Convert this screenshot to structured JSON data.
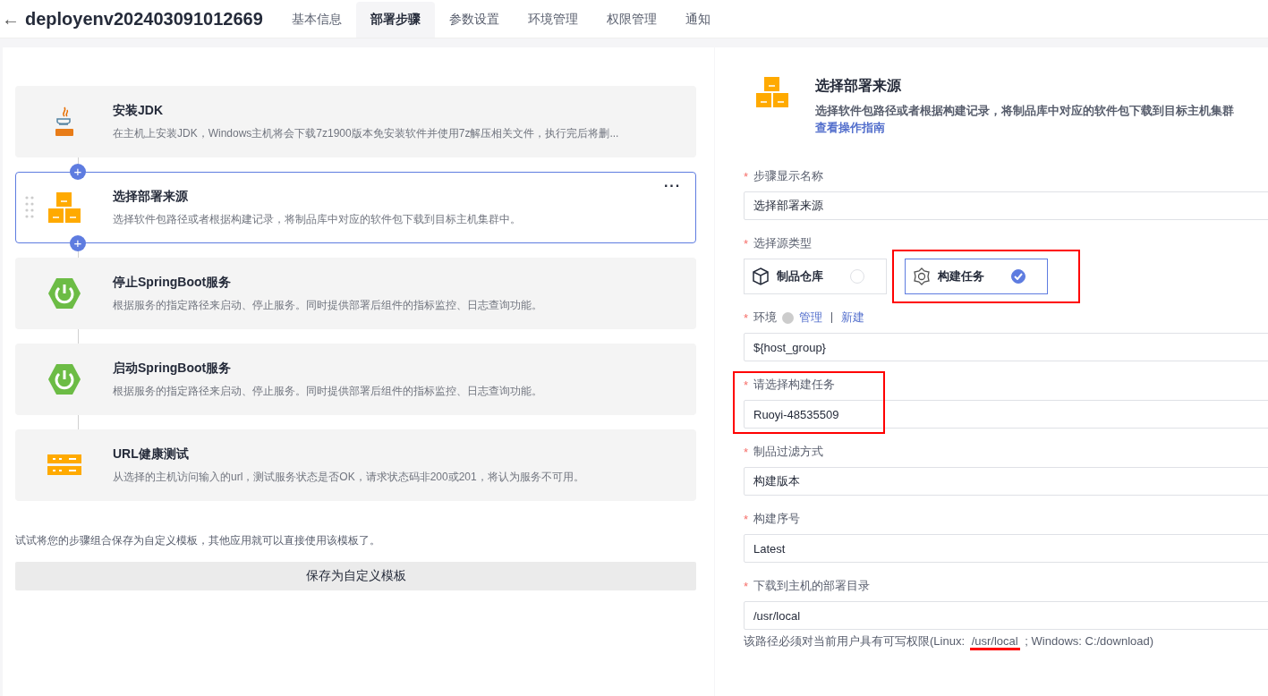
{
  "header": {
    "back": "←",
    "title": "deployenv202403091012669",
    "tabs": [
      {
        "label": "基本信息",
        "selected": false
      },
      {
        "label": "部署步骤",
        "selected": true
      },
      {
        "label": "参数设置",
        "selected": false
      },
      {
        "label": "环境管理",
        "selected": false
      },
      {
        "label": "权限管理",
        "selected": false
      },
      {
        "label": "通知",
        "selected": false
      }
    ]
  },
  "steps": [
    {
      "kind": "java",
      "title": "安装JDK",
      "desc": "在主机上安装JDK，Windows主机将会下载7z1900版本免安装软件并使用7z解压相关文件，执行完后将删...",
      "selected": false
    },
    {
      "kind": "boxes",
      "title": "选择部署来源",
      "desc": "选择软件包路径或者根据构建记录，将制品库中对应的软件包下载到目标主机集群中。",
      "selected": true,
      "add_before": "+",
      "add_after": "+",
      "more": "···"
    },
    {
      "kind": "spring",
      "title": "停止SpringBoot服务",
      "desc": "根据服务的指定路径来启动、停止服务。同时提供部署后组件的指标监控、日志查询功能。",
      "selected": false
    },
    {
      "kind": "spring",
      "title": "启动SpringBoot服务",
      "desc": "根据服务的指定路径来启动、停止服务。同时提供部署后组件的指标监控、日志查询功能。",
      "selected": false
    },
    {
      "kind": "server",
      "title": "URL健康测试",
      "desc": "从选择的主机访问输入的url，测试服务状态是否OK，请求状态码非200或201，将认为服务不可用。",
      "selected": false
    }
  ],
  "template_hint": "试试将您的步骤组合保存为自定义模板，其他应用就可以直接使用该模板了。",
  "save_template_button": "保存为自定义模板",
  "detail": {
    "title": "选择部署来源",
    "desc": "选择软件包路径或者根据构建记录，将制品库中对应的软件包下载到目标主机集群",
    "guide_link": "查看操作指南",
    "required_mark": "*",
    "fields": [
      {
        "kind": "input",
        "label": "步骤显示名称",
        "value": "选择部署来源",
        "highlighted": false
      },
      {
        "kind": "options",
        "label": "选择源类型",
        "highlighted": false,
        "options": [
          {
            "kind": "box",
            "label": "制品仓库",
            "selected": false,
            "highlighted": false
          },
          {
            "kind": "gear",
            "label": "构建任务",
            "selected": true,
            "highlighted": true
          }
        ]
      },
      {
        "kind": "input",
        "label": "环境",
        "value": "${host_group}",
        "highlighted": false,
        "links": [
          "管理",
          "新建"
        ]
      },
      {
        "kind": "input",
        "label": "请选择构建任务",
        "value": "Ruoyi-48535509",
        "highlighted": true
      },
      {
        "kind": "input",
        "label": "制品过滤方式",
        "value": "构建版本",
        "highlighted": false
      },
      {
        "kind": "input",
        "label": "构建序号",
        "value": "Latest",
        "highlighted": false
      },
      {
        "kind": "input",
        "label": "下载到主机的部署目录",
        "value": "/usr/local",
        "highlighted": false,
        "hint": {
          "before": "该路径必须对当前用户具有可写权限(Linux:",
          "marked": "/usr/local",
          "after": "; Windows: C:/download)"
        }
      }
    ]
  }
}
